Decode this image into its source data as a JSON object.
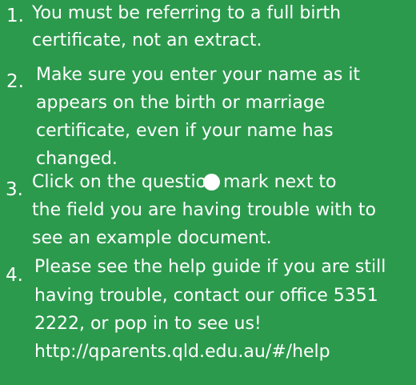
{
  "tips": [
    {
      "number": "1.",
      "lines": [
        "You must be referring to a full birth",
        "certificate, not an extract."
      ]
    },
    {
      "number": "2.",
      "lines": [
        "Make sure you enter your name as it",
        "appears on the birth or marriage",
        "certificate, even if your name has",
        "changed."
      ]
    },
    {
      "number": "3.",
      "lines": [
        "Click on the question mark next to",
        "the field you are having trouble with to",
        "see an example document."
      ]
    },
    {
      "number": "4.",
      "lines": [
        "Please see the help guide if you are still",
        "having trouble, contact our office 5351",
        "2222, or pop in to see us!",
        "http://qparents.qld.edu.au/#/help"
      ]
    }
  ]
}
